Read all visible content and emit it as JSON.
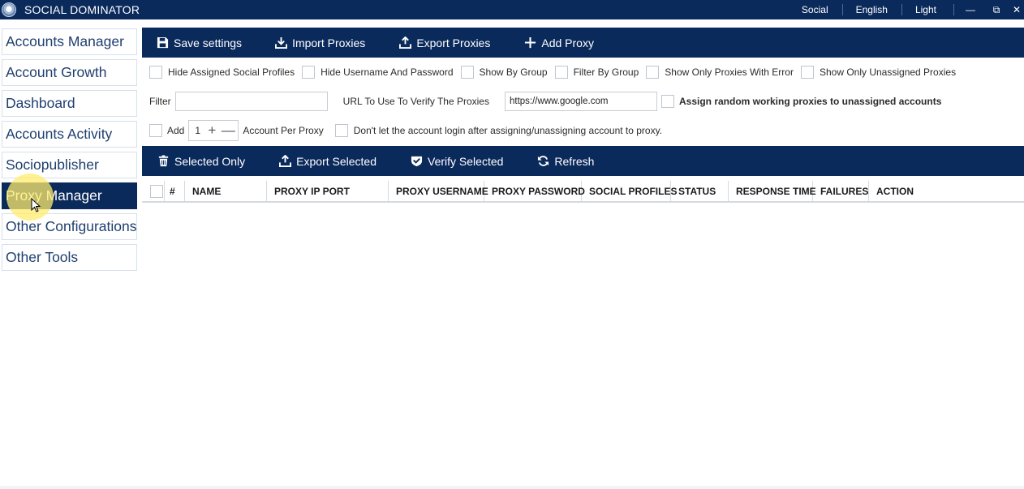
{
  "app": {
    "title": "SOCIAL DOMINATOR",
    "menu": [
      "Social",
      "English",
      "Light"
    ],
    "window_controls": {
      "minimize": "—",
      "restore": "⧉",
      "close": "✕"
    }
  },
  "sidebar": {
    "items": [
      {
        "label": "Accounts Manager"
      },
      {
        "label": "Account Growth"
      },
      {
        "label": "Dashboard"
      },
      {
        "label": "Accounts Activity"
      },
      {
        "label": "Sociopublisher"
      },
      {
        "label": "Proxy Manager",
        "active": true
      },
      {
        "label": "Other Configurations"
      },
      {
        "label": "Other Tools"
      }
    ]
  },
  "toolbar": {
    "save": "Save settings",
    "import": "Import Proxies",
    "export": "Export Proxies",
    "add": "Add Proxy"
  },
  "options": {
    "hide_assigned": "Hide Assigned Social Profiles",
    "hide_credentials": "Hide Username And Password",
    "show_by_group": "Show By Group",
    "filter_by_group": "Filter By Group",
    "only_errors": "Show Only Proxies With Error",
    "only_unassigned": "Show Only Unassigned Proxies"
  },
  "filter": {
    "label": "Filter",
    "value": "",
    "url_label": "URL To Use To Verify The Proxies",
    "url_value": "https://www.google.com",
    "assign_random": "Assign random working proxies to unassigned accounts"
  },
  "add_row": {
    "add_label": "Add",
    "count": "1",
    "plus": "+",
    "minus": "—",
    "per_proxy": "Account Per Proxy",
    "dont_login": "Don't let the account login after assigning/unassigning account to proxy."
  },
  "actions": {
    "selected_only": "Selected Only",
    "export_selected": "Export Selected",
    "verify_selected": "Verify Selected",
    "refresh": "Refresh"
  },
  "table": {
    "columns": [
      "#",
      "NAME",
      "PROXY IP PORT",
      "PROXY USERNAME",
      "PROXY PASSWORD",
      "SOCIAL PROFILES",
      "STATUS",
      "RESPONSE TIME",
      "FAILURES",
      "ACTION"
    ],
    "rows": []
  },
  "colors": {
    "brand": "#0b2a5c",
    "highlight": "#ffec6e"
  }
}
